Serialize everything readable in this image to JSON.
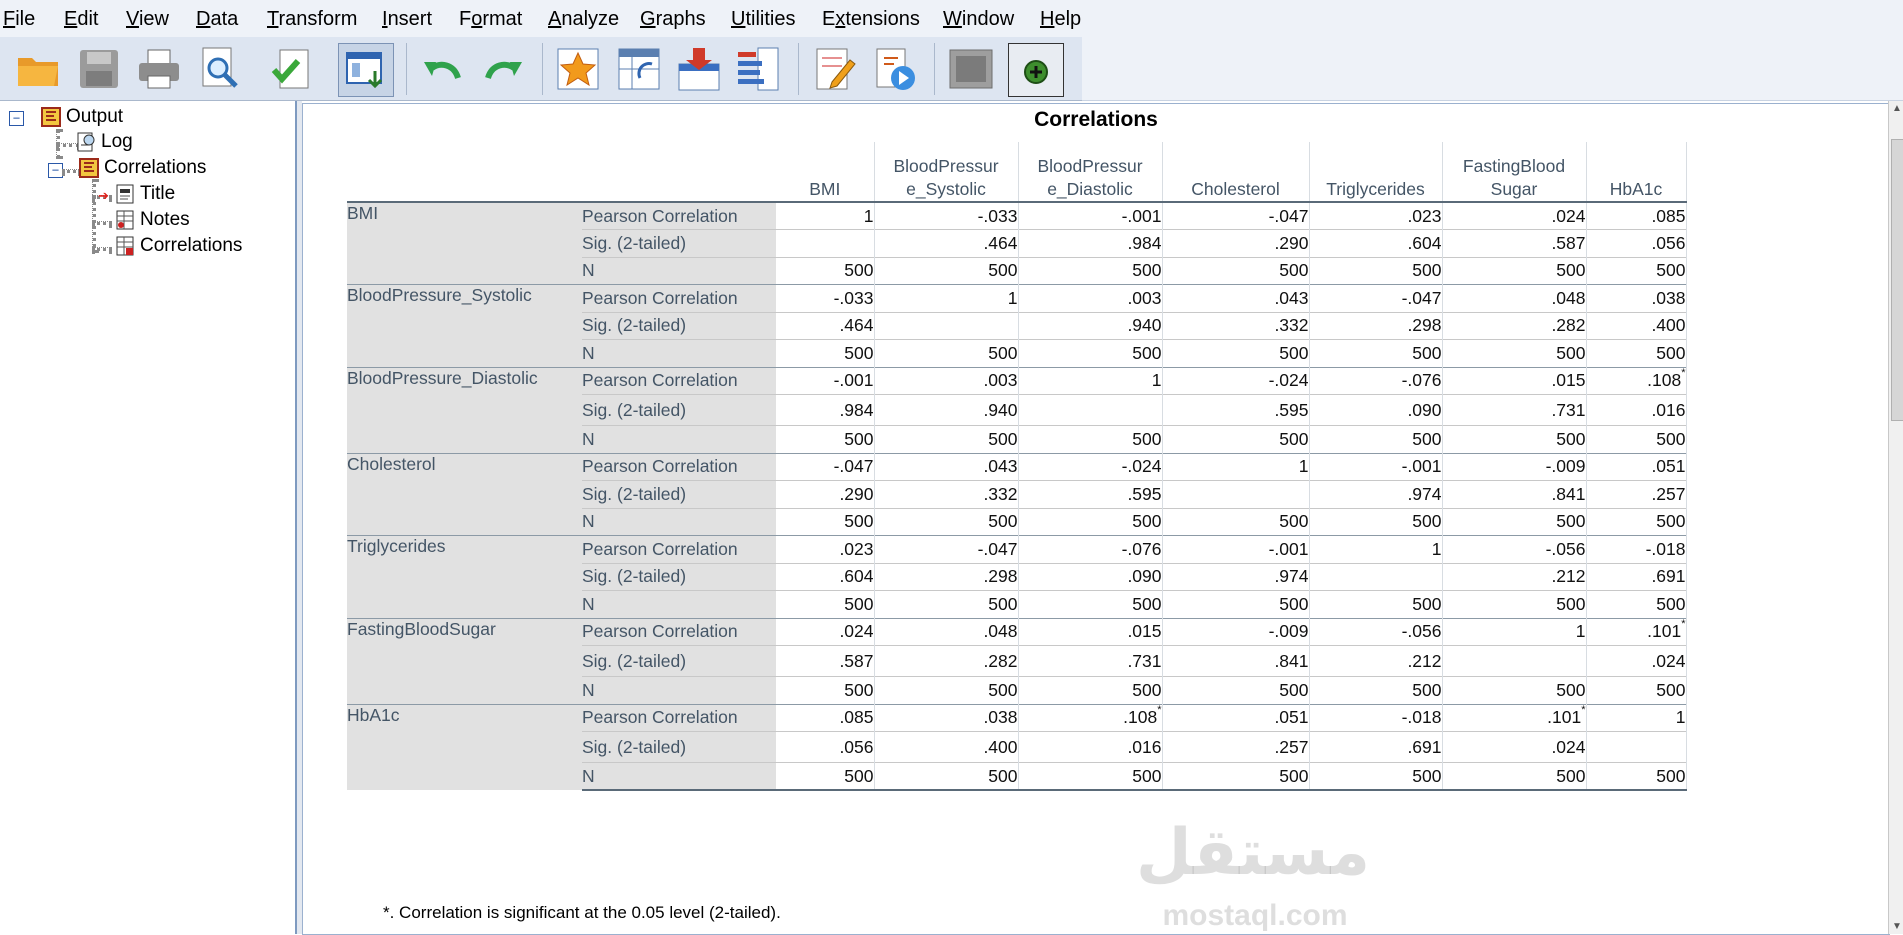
{
  "menu": [
    {
      "id": "file",
      "label": "File",
      "underline": 0
    },
    {
      "id": "edit",
      "label": "Edit",
      "underline": 0
    },
    {
      "id": "view",
      "label": "View",
      "underline": 0
    },
    {
      "id": "data",
      "label": "Data",
      "underline": 0
    },
    {
      "id": "transform",
      "label": "Transform",
      "underline": 0
    },
    {
      "id": "insert",
      "label": "Insert",
      "underline": 0
    },
    {
      "id": "format",
      "label": "Format",
      "underline": 1
    },
    {
      "id": "analyze",
      "label": "Analyze",
      "underline": 0
    },
    {
      "id": "graphs",
      "label": "Graphs",
      "underline": 0
    },
    {
      "id": "utilities",
      "label": "Utilities",
      "underline": 0
    },
    {
      "id": "extensions",
      "label": "Extensions",
      "underline": 1
    },
    {
      "id": "window",
      "label": "Window",
      "underline": 0
    },
    {
      "id": "help",
      "label": "Help",
      "underline": 0
    }
  ],
  "toolbar": [
    "open-icon",
    "save-icon",
    "print-icon",
    "print-preview-icon",
    "export-icon",
    "recall-dialog-icon",
    "undo-icon",
    "redo-icon",
    "go-to-data-icon",
    "go-to-case-icon",
    "variables-icon",
    "select-cases-icon",
    "designate-window-icon",
    "run-script-icon",
    "show-hide-icon",
    "insert-output-icon"
  ],
  "tree": {
    "output": "Output",
    "log": "Log",
    "correlations": "Correlations",
    "title": "Title",
    "notes": "Notes",
    "correlations_table": "Correlations"
  },
  "pivot": {
    "title": "Correlations",
    "columns": [
      [
        "BMI"
      ],
      [
        "BloodPressur",
        "e_Systolic"
      ],
      [
        "BloodPressur",
        "e_Diastolic"
      ],
      [
        "Cholesterol"
      ],
      [
        "Triglycerides"
      ],
      [
        "FastingBlood",
        "Sugar"
      ],
      [
        "HbA1c"
      ]
    ],
    "stat_labels": [
      "Pearson Correlation",
      "Sig. (2-tailed)",
      "N"
    ],
    "rows": [
      {
        "var": "BMI",
        "r": [
          "1",
          "-.033",
          "-.001",
          "-.047",
          ".023",
          ".024",
          ".085"
        ],
        "sig": [
          "",
          ".464",
          ".984",
          ".290",
          ".604",
          ".587",
          ".056"
        ],
        "n": [
          "500",
          "500",
          "500",
          "500",
          "500",
          "500",
          "500"
        ]
      },
      {
        "var": "BloodPressure_Systolic",
        "r": [
          "-.033",
          "1",
          ".003",
          ".043",
          "-.047",
          ".048",
          ".038"
        ],
        "sig": [
          ".464",
          "",
          ".940",
          ".332",
          ".298",
          ".282",
          ".400"
        ],
        "n": [
          "500",
          "500",
          "500",
          "500",
          "500",
          "500",
          "500"
        ]
      },
      {
        "var": "BloodPressure_Diastolic",
        "r": [
          "-.001",
          ".003",
          "1",
          "-.024",
          "-.076",
          ".015",
          ".108*"
        ],
        "sig": [
          ".984",
          ".940",
          "",
          ".595",
          ".090",
          ".731",
          ".016"
        ],
        "n": [
          "500",
          "500",
          "500",
          "500",
          "500",
          "500",
          "500"
        ]
      },
      {
        "var": "Cholesterol",
        "r": [
          "-.047",
          ".043",
          "-.024",
          "1",
          "-.001",
          "-.009",
          ".051"
        ],
        "sig": [
          ".290",
          ".332",
          ".595",
          "",
          ".974",
          ".841",
          ".257"
        ],
        "n": [
          "500",
          "500",
          "500",
          "500",
          "500",
          "500",
          "500"
        ]
      },
      {
        "var": "Triglycerides",
        "r": [
          ".023",
          "-.047",
          "-.076",
          "-.001",
          "1",
          "-.056",
          "-.018"
        ],
        "sig": [
          ".604",
          ".298",
          ".090",
          ".974",
          "",
          ".212",
          ".691"
        ],
        "n": [
          "500",
          "500",
          "500",
          "500",
          "500",
          "500",
          "500"
        ]
      },
      {
        "var": "FastingBloodSugar",
        "r": [
          ".024",
          ".048",
          ".015",
          "-.009",
          "-.056",
          "1",
          ".101*"
        ],
        "sig": [
          ".587",
          ".282",
          ".731",
          ".841",
          ".212",
          "",
          ".024"
        ],
        "n": [
          "500",
          "500",
          "500",
          "500",
          "500",
          "500",
          "500"
        ]
      },
      {
        "var": "HbA1c",
        "r": [
          ".085",
          ".038",
          ".108*",
          ".051",
          "-.018",
          ".101*",
          "1"
        ],
        "sig": [
          ".056",
          ".400",
          ".016",
          ".257",
          ".691",
          ".024",
          ""
        ],
        "n": [
          "500",
          "500",
          "500",
          "500",
          "500",
          "500",
          "500"
        ]
      }
    ],
    "footnote": "*. Correlation is significant at the 0.05 level (2-tailed)."
  },
  "watermark": {
    "arabic": "مستقل",
    "latin": "mostaql.com"
  }
}
